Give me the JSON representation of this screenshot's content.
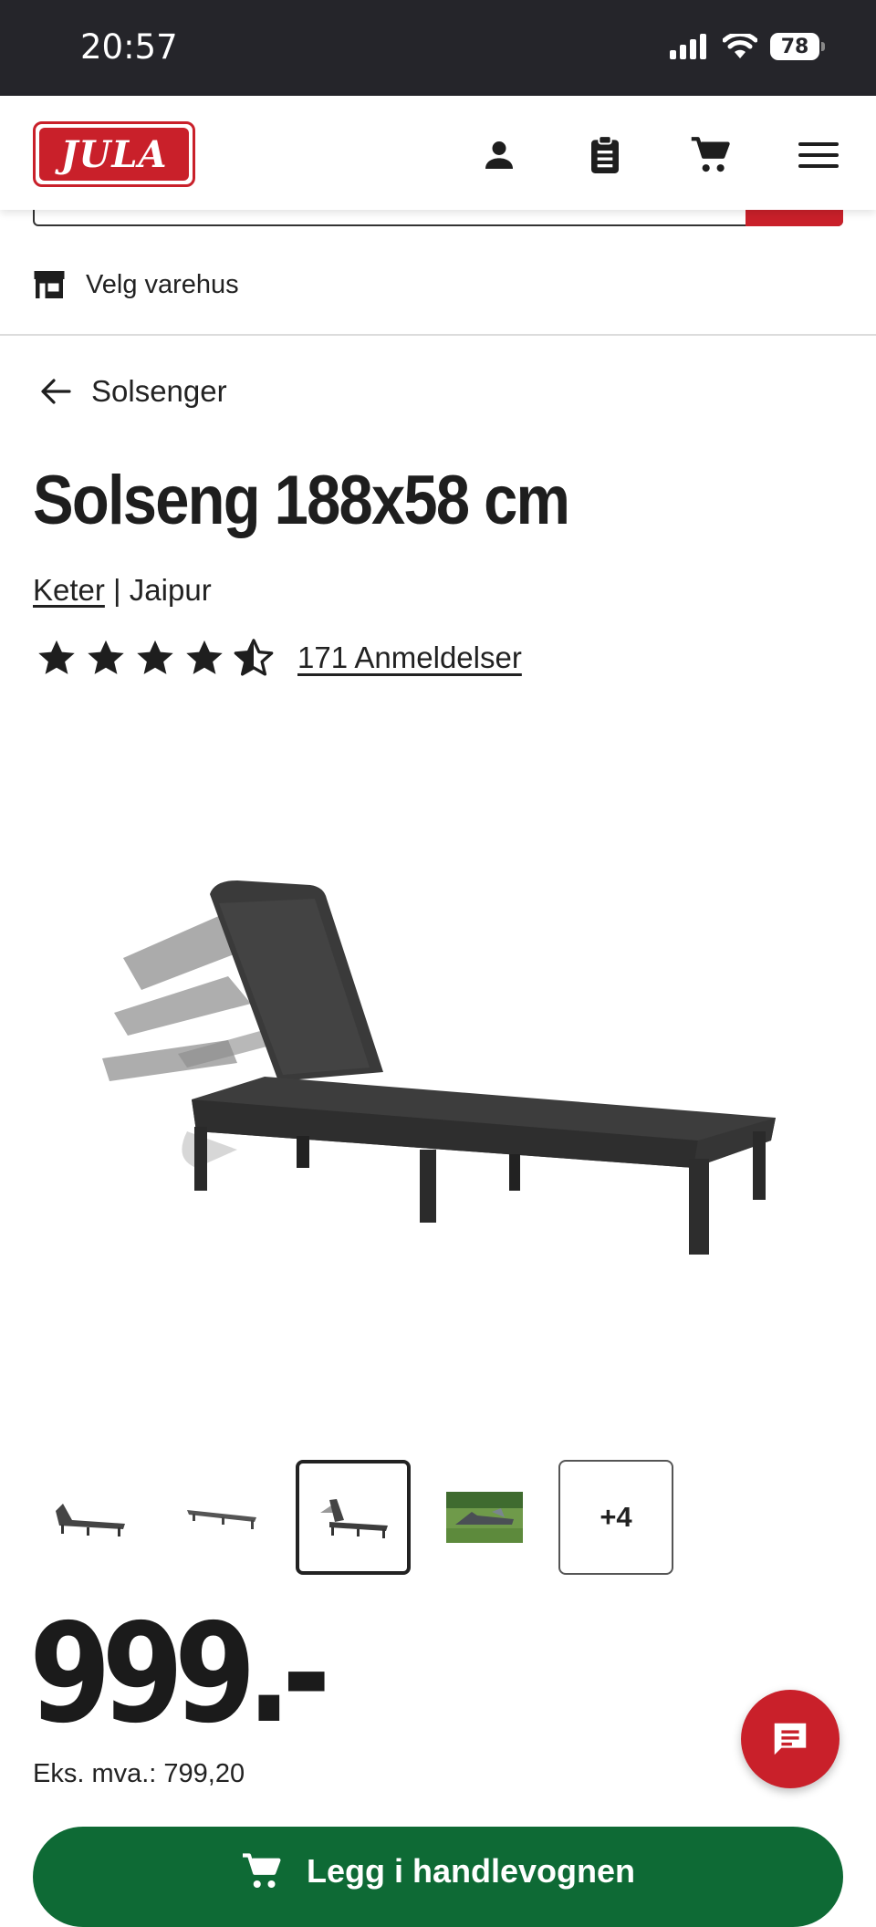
{
  "status_bar": {
    "time": "20:57",
    "battery": "78"
  },
  "header": {
    "logo_text": "JULA",
    "icons": [
      "user-icon",
      "shopping-list-icon",
      "cart-icon",
      "menu-icon"
    ]
  },
  "store": {
    "label": "Velg varehus"
  },
  "breadcrumb": {
    "back_label": "Solsenger"
  },
  "product": {
    "title": "Solseng 188x58 cm",
    "brand": "Keter",
    "separator": " | ",
    "series": "Jaipur",
    "rating_value": 4.5,
    "reviews_label": "171 Anmeldelser",
    "more_images_label": "+4",
    "price": "999.-",
    "price_ex_vat": "Eks. mva.: 799,20"
  },
  "actions": {
    "add_to_cart_label": "Legg i handlevognen"
  },
  "colors": {
    "brand_red": "#c9202a",
    "cta_green": "#0e6a35",
    "statusbar": "#25252a"
  }
}
